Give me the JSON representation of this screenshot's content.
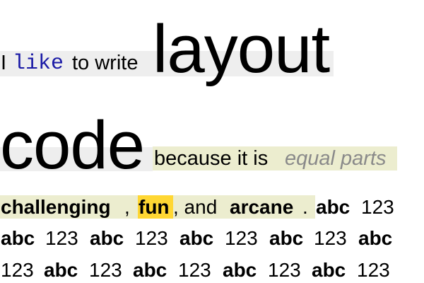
{
  "line1": {
    "w1": "I",
    "w2": "like",
    "w3": "to write",
    "w4": "layout"
  },
  "line2": {
    "w1": "code",
    "w2": "because it is",
    "w3": "equal parts"
  },
  "line3": {
    "w1": "challenging",
    "w2": ",",
    "w3": "fun",
    "w4": ", and",
    "w5": "arcane",
    "w6": ".",
    "w7": "abc",
    "w8": "123"
  },
  "line4": {
    "items": [
      "abc",
      "123",
      "abc",
      "123",
      "abc",
      "123",
      "abc",
      "123",
      "abc"
    ]
  },
  "line5": {
    "items": [
      "123",
      "abc",
      "123",
      "abc",
      "123",
      "abc",
      "123",
      "abc",
      "123"
    ]
  },
  "colors": {
    "gray_highlight": "#eeeeee",
    "olive_highlight": "#ecedcf",
    "yellow_highlight": "#ffd733",
    "mono_blue": "#1a1aa6",
    "italic_gray": "#8a8a8a"
  }
}
